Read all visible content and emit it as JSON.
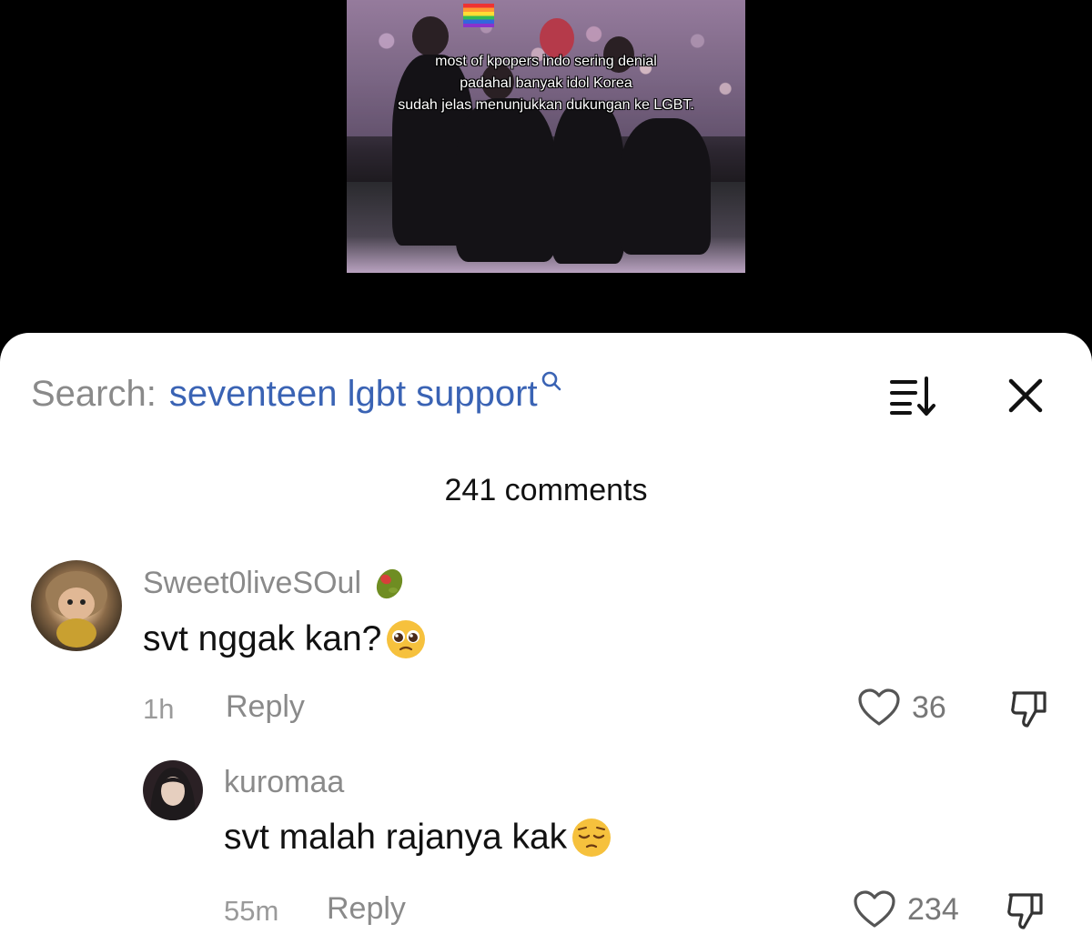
{
  "video": {
    "caption_lines": [
      "most of kpopers indo sering denial",
      "padahal banyak idol Korea",
      "sudah jelas menunjukkan dukungan ke LGBT."
    ]
  },
  "sheet": {
    "search_prefix": "Search:",
    "search_query": "seventeen lgbt support",
    "comment_count": "241 comments"
  },
  "comments": [
    {
      "username": "Sweet0liveSOul",
      "username_emoji": "olive",
      "text": "svt nggak kan?",
      "text_emoji": "pleading-face",
      "time": "1h",
      "reply_label": "Reply",
      "likes": "36"
    },
    {
      "username": "kuromaa",
      "text": "svt malah rajanya kak",
      "text_emoji": "pensive-face",
      "time": "55m",
      "reply_label": "Reply",
      "likes": "234"
    }
  ],
  "colors": {
    "search_query": "#3a63b4",
    "muted_text": "#8a8a8a",
    "background_top": "#000000",
    "sheet": "#ffffff"
  }
}
